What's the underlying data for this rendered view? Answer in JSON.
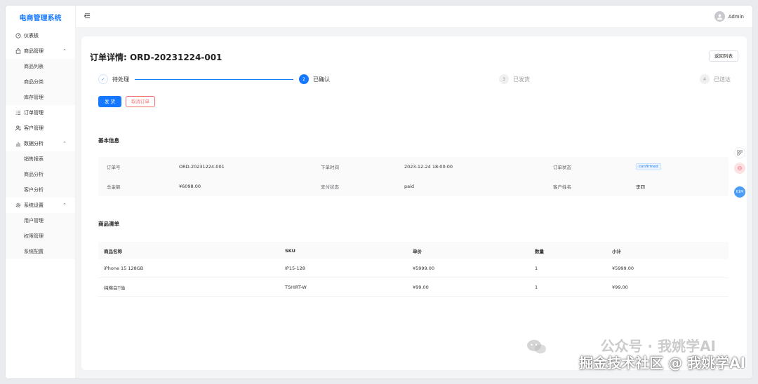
{
  "app": {
    "title": "电商管理系统"
  },
  "sidebar": {
    "items": [
      {
        "label": "仪表板",
        "icon": "dashboard-icon"
      },
      {
        "label": "商品管理",
        "icon": "bag-icon",
        "expanded": true,
        "children": [
          "商品列表",
          "商品分类",
          "库存管理"
        ]
      },
      {
        "label": "订单管理",
        "icon": "list-icon"
      },
      {
        "label": "客户管理",
        "icon": "users-icon"
      },
      {
        "label": "数据分析",
        "icon": "chart-icon",
        "expanded": true,
        "children": [
          "销售报表",
          "商品分析",
          "客户分析"
        ]
      },
      {
        "label": "系统设置",
        "icon": "gear-icon",
        "expanded": true,
        "children": [
          "用户管理",
          "权限管理",
          "系统配置"
        ]
      }
    ]
  },
  "topbar": {
    "user": "Admin"
  },
  "page": {
    "title": "订单详情: ORD-20231224-001",
    "back_label": "返回列表",
    "steps": [
      {
        "num": "✓",
        "label": "待处理",
        "status": "done"
      },
      {
        "num": "2",
        "label": "已确认",
        "status": "active"
      },
      {
        "num": "3",
        "label": "已发货",
        "status": "wait"
      },
      {
        "num": "4",
        "label": "已送达",
        "status": "wait"
      }
    ],
    "ship_label": "发 货",
    "cancel_label": "取消订单",
    "basic_title": "基本信息",
    "info": {
      "order_no_label": "订单号",
      "order_no": "ORD-20231224-001",
      "time_label": "下单时间",
      "time": "2023-12-24 18:00:00",
      "status_label": "订单状态",
      "status": "confirmed",
      "total_label": "总金额",
      "total": "¥6098.00",
      "pay_label": "支付状态",
      "pay": "paid",
      "customer_label": "客户姓名",
      "customer": "李四"
    },
    "items_title": "商品清单",
    "table": {
      "headers": [
        "商品名称",
        "SKU",
        "单价",
        "数量",
        "小计"
      ],
      "rows": [
        [
          "iPhone 15 128GB",
          "IP15-128",
          "¥5999.00",
          "1",
          "¥5999.00"
        ],
        [
          "纯棉白T恤",
          "TSHIRT-W",
          "¥99.00",
          "1",
          "¥99.00"
        ]
      ]
    }
  },
  "floating": {
    "badge": "61M"
  },
  "watermark": {
    "line1": "公众号 · 我姚学AI",
    "line2": "掘金技术社区 @ 我姚学AI"
  },
  "colors": {
    "primary": "#1677ff",
    "danger": "#f56c6c"
  }
}
